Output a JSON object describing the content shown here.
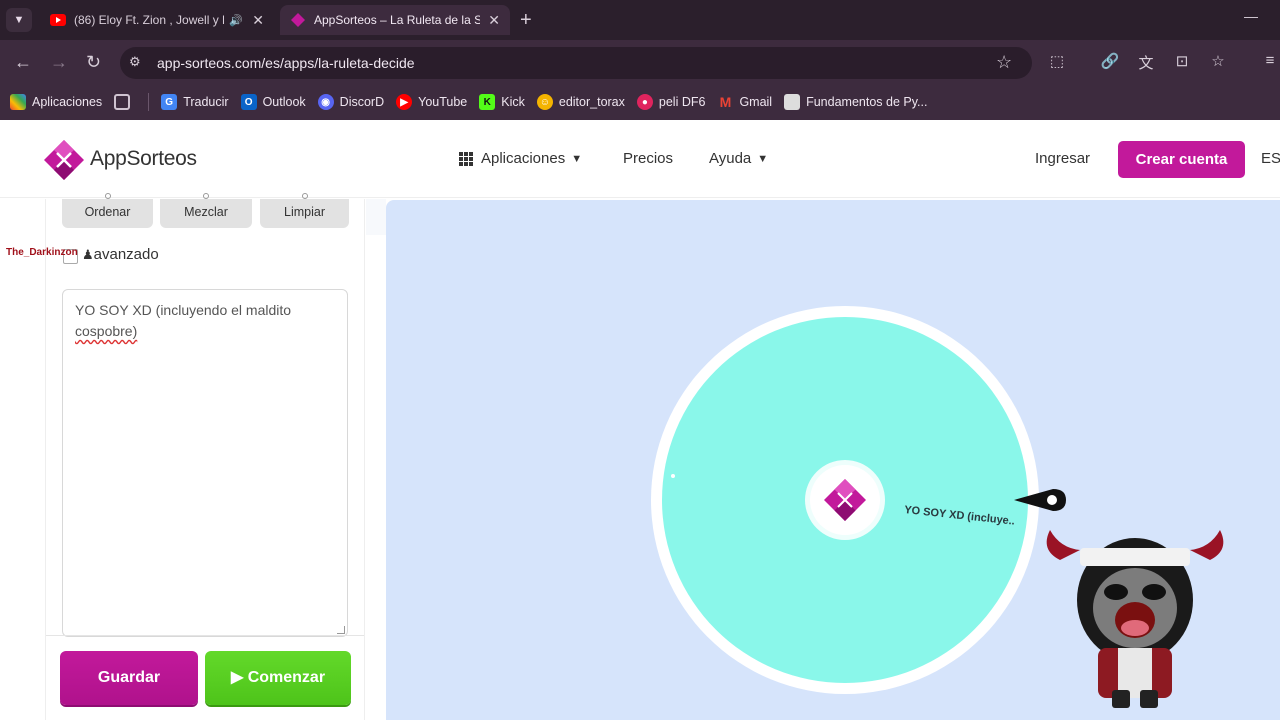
{
  "browser": {
    "tabs": [
      {
        "title": "(86) Eloy Ft. Zion , Jowell y R",
        "active": false,
        "favicon": "youtube-icon"
      },
      {
        "title": "AppSorteos – La Ruleta de la Su",
        "active": true,
        "favicon": "appsorteos-icon"
      }
    ],
    "url": "app-sorteos.com/es/apps/la-ruleta-decide",
    "bookmarks": [
      {
        "label": "Aplicaciones",
        "icon": "apps-grid-icon",
        "color": "#e8453c"
      },
      {
        "label": "Traducir",
        "icon": "translate-icon",
        "color": "#4285f4"
      },
      {
        "label": "Outlook",
        "icon": "outlook-icon",
        "color": "#0a64c8"
      },
      {
        "label": "DiscorD",
        "icon": "discord-icon",
        "color": "#5865f2"
      },
      {
        "label": "YouTube",
        "icon": "youtube-icon",
        "color": "#ff0000"
      },
      {
        "label": "Kick",
        "icon": "kick-icon",
        "color": "#53fc18"
      },
      {
        "label": "editor_torax",
        "icon": "emoji-icon",
        "color": "#f4b400"
      },
      {
        "label": "peli DF6",
        "icon": "movie-icon",
        "color": "#e0245e"
      },
      {
        "label": "Gmail",
        "icon": "gmail-icon",
        "color": "#ea4335"
      },
      {
        "label": "Fundamentos de Py...",
        "icon": "doc-icon",
        "color": "#dddddd"
      }
    ]
  },
  "site": {
    "logo_text": "AppSorteos",
    "nav": {
      "aplicaciones": "Aplicaciones",
      "precios": "Precios",
      "ayuda": "Ayuda"
    },
    "ingresar": "Ingresar",
    "crear_cuenta": "Crear cuenta",
    "lang": "ES",
    "brand_color": "#c2199b"
  },
  "panel": {
    "buttons": {
      "ordenar": "Ordenar",
      "mezclar": "Mezclar",
      "limpiar": "Limpiar"
    },
    "avanzado": "avanzado",
    "textarea_line1": "YO SOY XD (incluyendo el maldito",
    "textarea_line2": "cospobre)",
    "guardar": "Guardar",
    "comenzar": "Comenzar",
    "overlay_tag": "The_Darkinzon"
  },
  "wheel": {
    "segment_label": "YO SOY XD (incluye..",
    "segment_color": "#8af7ea",
    "background_color": "#d6e4fb"
  }
}
